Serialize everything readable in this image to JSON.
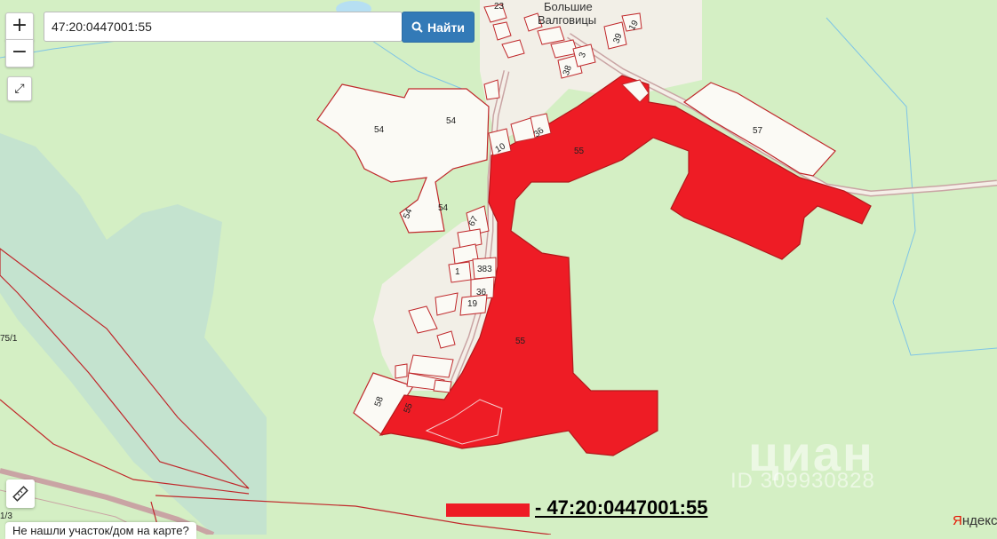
{
  "search": {
    "value": "47:20:0447001:55",
    "button_label": "Найти"
  },
  "controls": {
    "zoom_in": "+",
    "zoom_out": "−",
    "fullscreen": "⤢"
  },
  "settlement": {
    "line1": "Большие",
    "line2": "Валговицы"
  },
  "parcels": {
    "p54a": "54",
    "p54b": "54",
    "p54c": "54",
    "p54d": "54",
    "p55a": "55",
    "p55b": "55",
    "p55c": "55",
    "p57": "57",
    "p58": "58",
    "p23": "23",
    "p19a": "19",
    "p39": "39",
    "p3": "3",
    "p38a": "38",
    "p10": "10",
    "p36a": "36",
    "p67": "67",
    "p383": "383",
    "p36b": "36",
    "p19b": "19",
    "p1": "1",
    "edge_left": "75/1",
    "edge_bottom": "1/3"
  },
  "not_found_label": "Не нашли участок/дом на карте?",
  "legend": {
    "text": "- 47:20:0447001:55",
    "color": "#ee1c25"
  },
  "watermark": {
    "brand": "циан",
    "id": "ID 309930828"
  },
  "yandex": {
    "y": "Я",
    "rest": "ндекс"
  },
  "colors": {
    "parcel_fill": "#ee1c25",
    "parcel_border": "#b3181b",
    "field": "#d4efc4",
    "settlement": "#f7f4ee",
    "search_button": "#337ab7"
  }
}
